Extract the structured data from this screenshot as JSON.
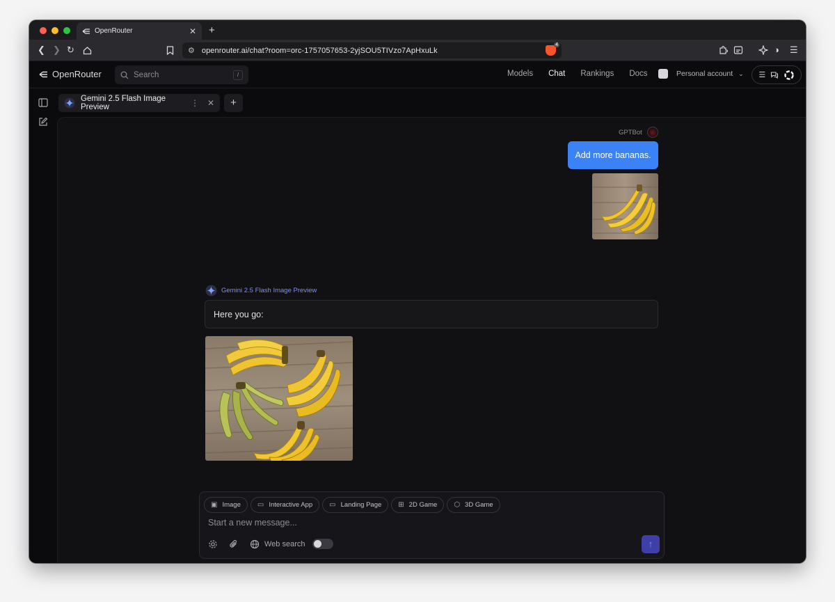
{
  "browser": {
    "tab_title": "OpenRouter",
    "url": "openrouter.ai/chat?room=orc-1757057653-2yjSOU5TIVzo7ApHxuLk",
    "shield_count": "4",
    "traffic_colors": [
      "#ff5f57",
      "#febc2e",
      "#28c840"
    ]
  },
  "header": {
    "brand": "OpenRouter",
    "search_placeholder": "Search",
    "search_shortcut": "/",
    "nav": [
      "Models",
      "Chat",
      "Rankings",
      "Docs"
    ],
    "active_nav": "Chat",
    "account": "Personal account"
  },
  "chat_tab": {
    "model_name": "Gemini 2.5 Flash Image Preview"
  },
  "messages": {
    "user_name": "GPTBot",
    "user_text": "Add more bananas.",
    "bot_name": "Gemini 2.5 Flash Image Preview",
    "bot_text": "Here you go:"
  },
  "composer": {
    "chips": [
      "Image",
      "Interactive App",
      "Landing Page",
      "2D Game",
      "3D Game"
    ],
    "placeholder": "Start a new message...",
    "web_search_label": "Web search",
    "web_search_enabled": false
  },
  "colors": {
    "accent_blue": "#3b82f6",
    "model_label": "#7f8ff7",
    "send_button": "#3f3fa8"
  }
}
